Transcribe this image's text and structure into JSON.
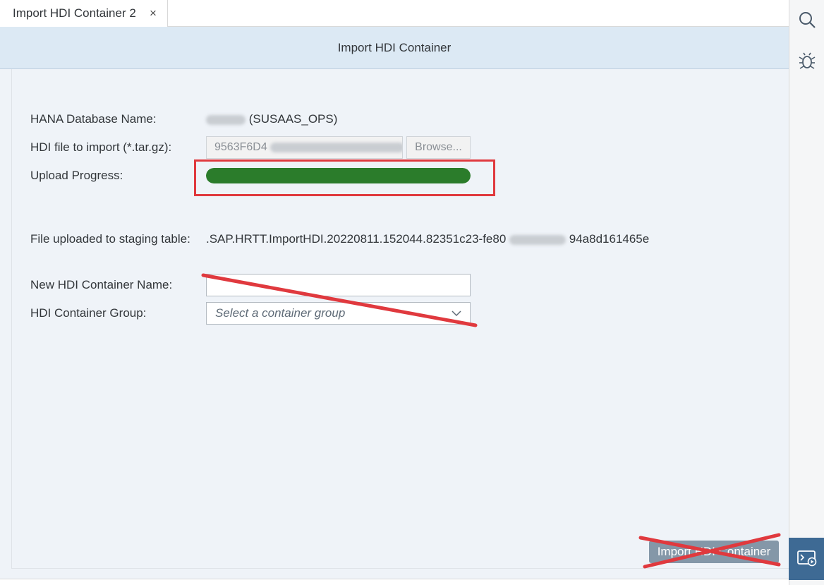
{
  "tab": {
    "title": "Import HDI Container 2",
    "close_glyph": "×"
  },
  "rail": {
    "top_icons": [
      "search-icon",
      "debug-bug-icon"
    ],
    "bottom_icon": "run-console-icon"
  },
  "panel": {
    "title": "Import HDI Container"
  },
  "form": {
    "db_name_label": "HANA Database Name:",
    "db_name_value": "(SUSAAS_OPS)",
    "file_label": "HDI file to import (*.tar.gz):",
    "file_value_visible": "9563F6D4",
    "file_value_suffix": "..",
    "browse_label": "Browse...",
    "progress_label": "Upload Progress:",
    "progress_fraction": 1.0,
    "staging_label": "File uploaded to staging table:",
    "staging_value_start": ".SAP.HRTT.ImportHDI.20220811.152044.",
    "staging_value_mid": "82351c23-fe80",
    "staging_value_end": "94a8d161465e",
    "container_name_label": "New HDI Container Name:",
    "container_name_value": "",
    "container_group_label": "HDI Container Group:",
    "container_group_placeholder": "Select a container group"
  },
  "footer": {
    "import_button_label": "Import HDI Container"
  },
  "colors": {
    "progress": "#2b7c2b",
    "annotation_red": "#e0393e",
    "header_bg": "#dce9f4",
    "accent": "#3e6a94"
  }
}
